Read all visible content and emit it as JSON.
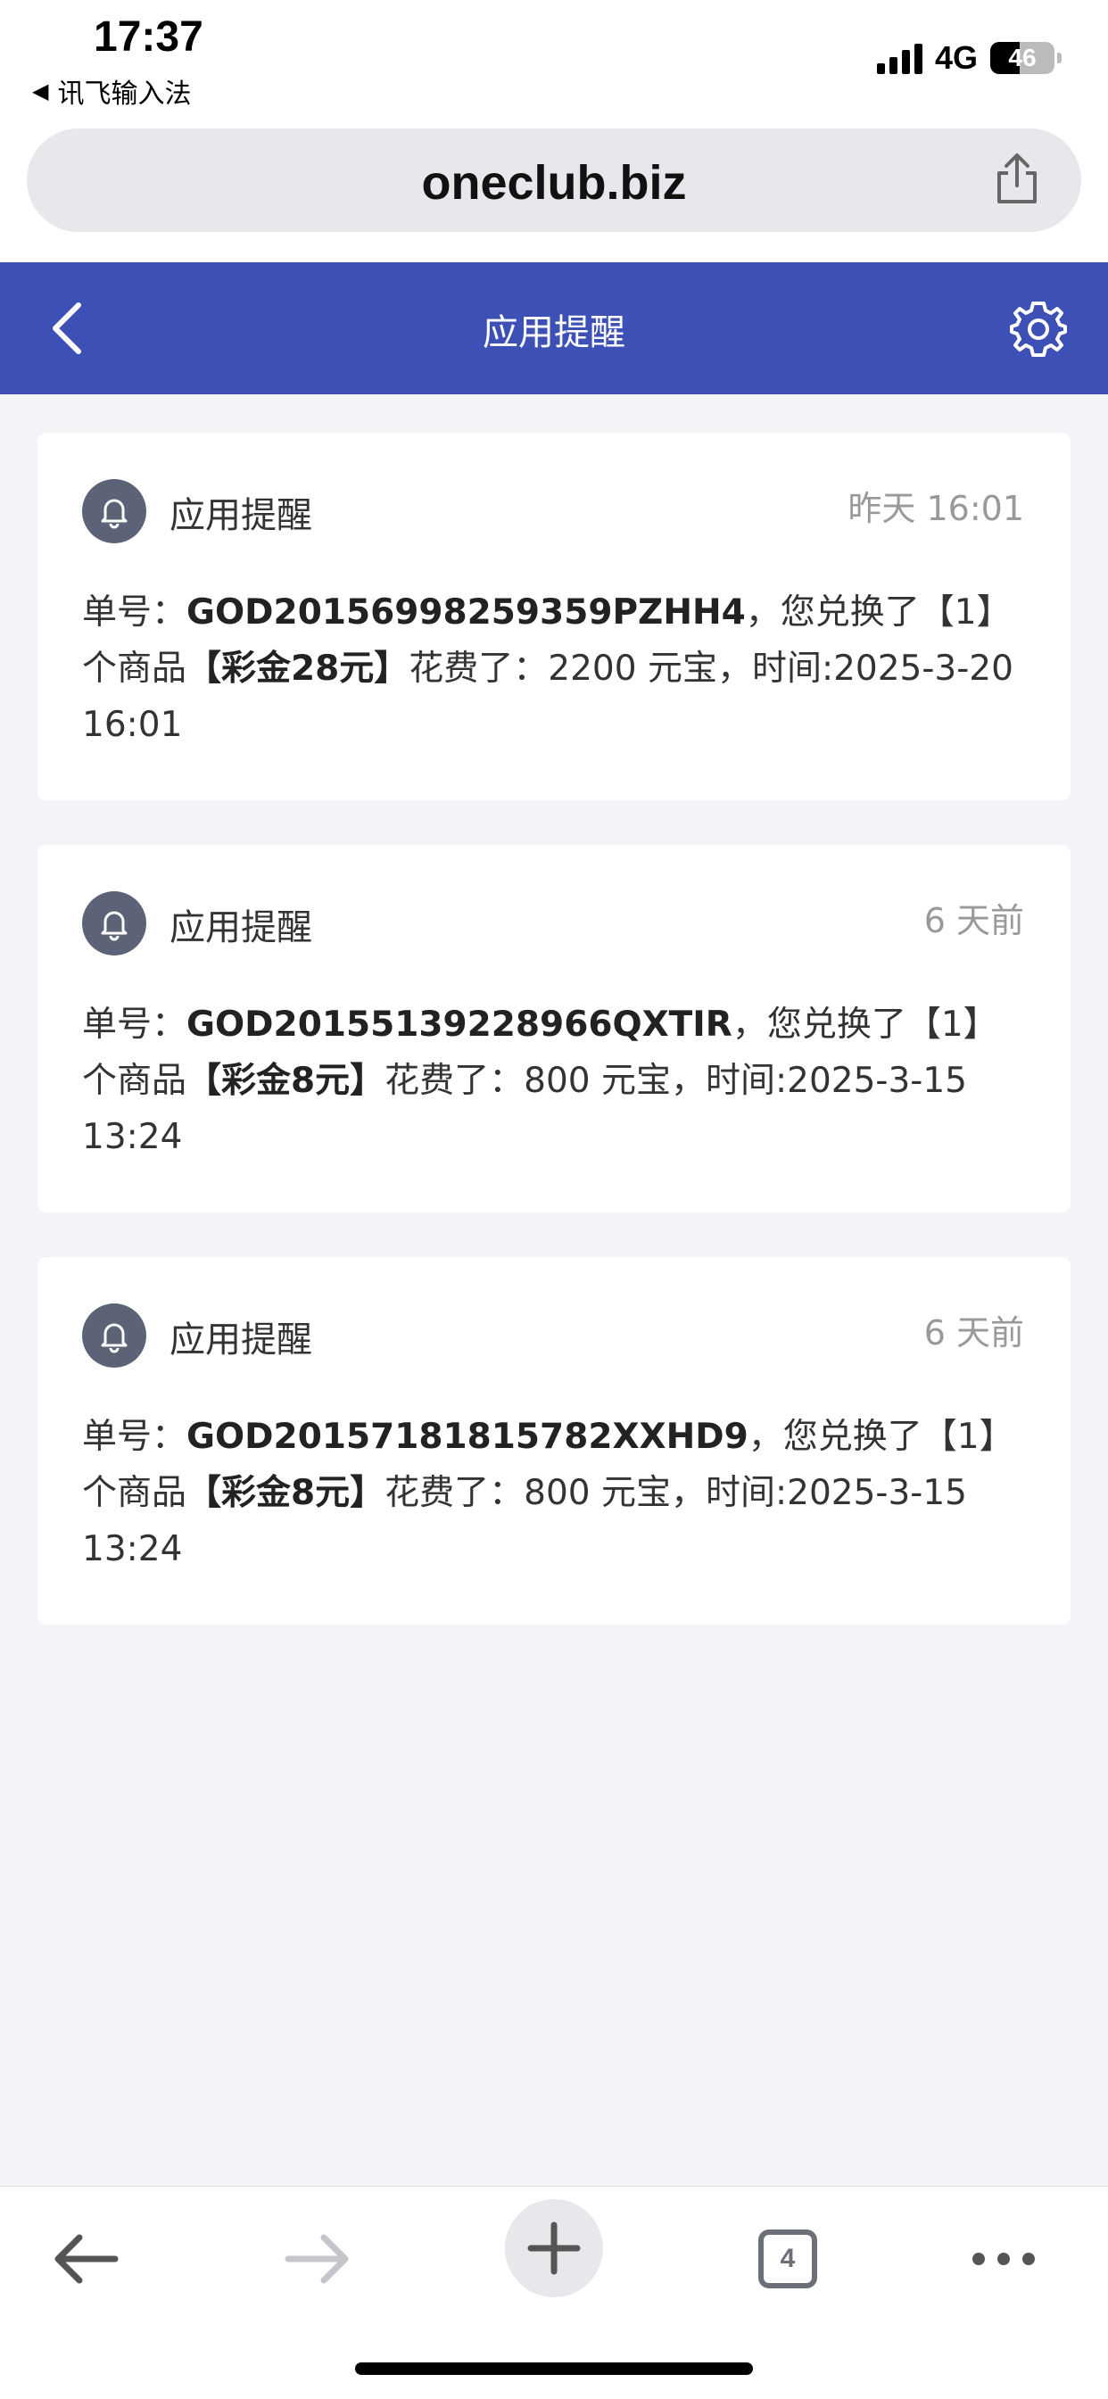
{
  "status_bar": {
    "time": "17:37",
    "back_app": "讯飞输入法",
    "network": "4G",
    "battery": "46",
    "battery_level": 0.46
  },
  "address_bar": {
    "url": "oneclub.biz"
  },
  "header": {
    "title": "应用提醒"
  },
  "notifications": [
    {
      "title": "应用提醒",
      "timestamp": "昨天 16:01",
      "label_order": "单号：",
      "order_id": "GOD20156998259359PZHH4",
      "text_mid": "，您兑换了【1】个商品",
      "item": "【彩金28元】",
      "text_tail": "花费了：2200 元宝，时间:2025-3-20 16:01"
    },
    {
      "title": "应用提醒",
      "timestamp": "6 天前",
      "label_order": "单号：",
      "order_id": "GOD20155139228966QXTIR",
      "text_mid": "，您兑换了【1】个商品",
      "item": "【彩金8元】",
      "text_tail": "花费了：800 元宝，时间:2025-3-15 13:24"
    },
    {
      "title": "应用提醒",
      "timestamp": "6 天前",
      "label_order": "单号：",
      "order_id": "GOD20157181815782XXHD9",
      "text_mid": "，您兑换了【1】个商品",
      "item": "【彩金8元】",
      "text_tail": "花费了：800 元宝，时间:2025-3-15 13:24"
    }
  ],
  "toolbar": {
    "tabs_count": "4"
  },
  "icons": {
    "back": "chevron-left-icon",
    "settings": "gear-icon",
    "bell": "bell-icon",
    "share": "share-icon"
  },
  "colors": {
    "header_bg": "#3d50b5",
    "page_bg": "#f3f4f8",
    "bell_bg": "#5d6377"
  }
}
